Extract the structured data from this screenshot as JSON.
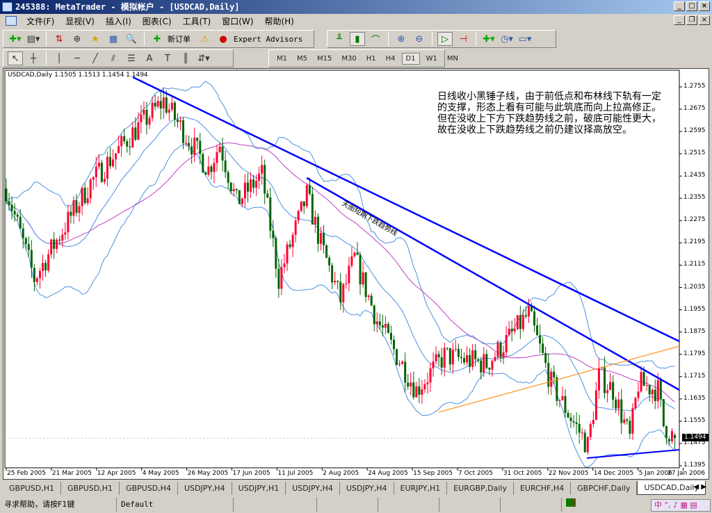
{
  "window": {
    "title": "245388: MetaTrader - 模拟帐户 - [USDCAD,Daily]"
  },
  "menu": [
    "文件(F)",
    "显视(V)",
    "插入(I)",
    "图表(C)",
    "工具(T)",
    "窗口(W)",
    "帮助(H)"
  ],
  "toolbar": {
    "new_order": "新订单",
    "expert_advisors": "Expert Advisors"
  },
  "timeframes": [
    "M1",
    "M5",
    "M15",
    "M30",
    "H1",
    "H4",
    "D1",
    "W1",
    "MN"
  ],
  "active_timeframe": "D1",
  "chart": {
    "header": "USDCAD,Daily  1.1505 1.1513 1.1454 1.1494",
    "note": "日线收小黑锤子线，由于前低点和布林线下轨有一定的支撑，形态上看有可能与此筑底而向上拉高修正。但在没收上下方下跌趋势线之前，破底可能性更大，故在没收上下跌趋势线之前仍建议择高放空。",
    "trendline_label": "天图短期下跌趋势线",
    "current_price": "1.1494"
  },
  "chart_data": {
    "type": "candlestick",
    "symbol": "USDCAD",
    "period": "Daily",
    "last_bar": {
      "open": 1.1505,
      "high": 1.1513,
      "low": 1.1454,
      "close": 1.1494
    },
    "y_ticks": [
      "1.2755",
      "1.2675",
      "1.2595",
      "1.2515",
      "1.2435",
      "1.2355",
      "1.2275",
      "1.2195",
      "1.2115",
      "1.2035",
      "1.1955",
      "1.1875",
      "1.1795",
      "1.1715",
      "1.1635",
      "1.1555",
      "1.1475",
      "1.1395"
    ],
    "ylim": [
      1.1395,
      1.2755
    ],
    "x_ticks": [
      "25 Feb 2005",
      "21 Mar 2005",
      "12 Apr 2005",
      "4 May 2005",
      "26 May 2005",
      "17 Jun 2005",
      "11 Jul 2005",
      "2 Aug 2005",
      "24 Aug 2005",
      "15 Sep 2005",
      "7 Oct 2005",
      "31 Oct 2005",
      "22 Nov 2005",
      "14 Dec 2005",
      "5 Jan 2006",
      "27 Jan 2006"
    ],
    "approx_close_path": [
      [
        0,
        1.239
      ],
      [
        10,
        1.2066
      ],
      [
        20,
        1.224
      ],
      [
        30,
        1.241
      ],
      [
        45,
        1.259
      ],
      [
        56,
        1.2705
      ],
      [
        65,
        1.2565
      ],
      [
        72,
        1.246
      ],
      [
        76,
        1.255
      ],
      [
        82,
        1.234
      ],
      [
        91,
        1.244
      ],
      [
        97,
        1.2066
      ],
      [
        102,
        1.2216
      ],
      [
        107,
        1.2366
      ],
      [
        112,
        1.219
      ],
      [
        119,
        1.199
      ],
      [
        124,
        1.214
      ],
      [
        132,
        1.1916
      ],
      [
        146,
        1.1667
      ],
      [
        156,
        1.179
      ],
      [
        171,
        1.176
      ],
      [
        176,
        1.1817
      ],
      [
        186,
        1.194
      ],
      [
        194,
        1.169
      ],
      [
        201,
        1.1567
      ],
      [
        207,
        1.1467
      ],
      [
        211,
        1.1717
      ],
      [
        216,
        1.1667
      ],
      [
        222,
        1.1492
      ],
      [
        225,
        1.169
      ],
      [
        232,
        1.1667
      ],
      [
        234,
        1.154
      ],
      [
        238,
        1.1494
      ]
    ],
    "indicators": [
      "Bollinger Bands",
      "Moving Average"
    ],
    "colors": {
      "bull": "#ff0033",
      "bear": "#006400",
      "bands": "#4a90e2",
      "ma": "#c040c0",
      "trend": "#0000ff",
      "support": "#ff9020"
    }
  },
  "tabs": [
    "GBPUSD,H1",
    "GBPUSD,H1",
    "GBPUSD,H4",
    "USDJPY,H4",
    "USDJPY,H1",
    "USDJPY,H4",
    "USDJPY,H4",
    "EURJPY,H1",
    "EURGBP,Daily",
    "EURCHF,H4",
    "GBPCHF,Daily",
    "USDCAD,Daily"
  ],
  "active_tab": "USDCAD,Daily",
  "status": {
    "help": "寻求帮助，请按F1键",
    "profile": "Default"
  },
  "ime": "中 °, ♪ ▦ ▤"
}
